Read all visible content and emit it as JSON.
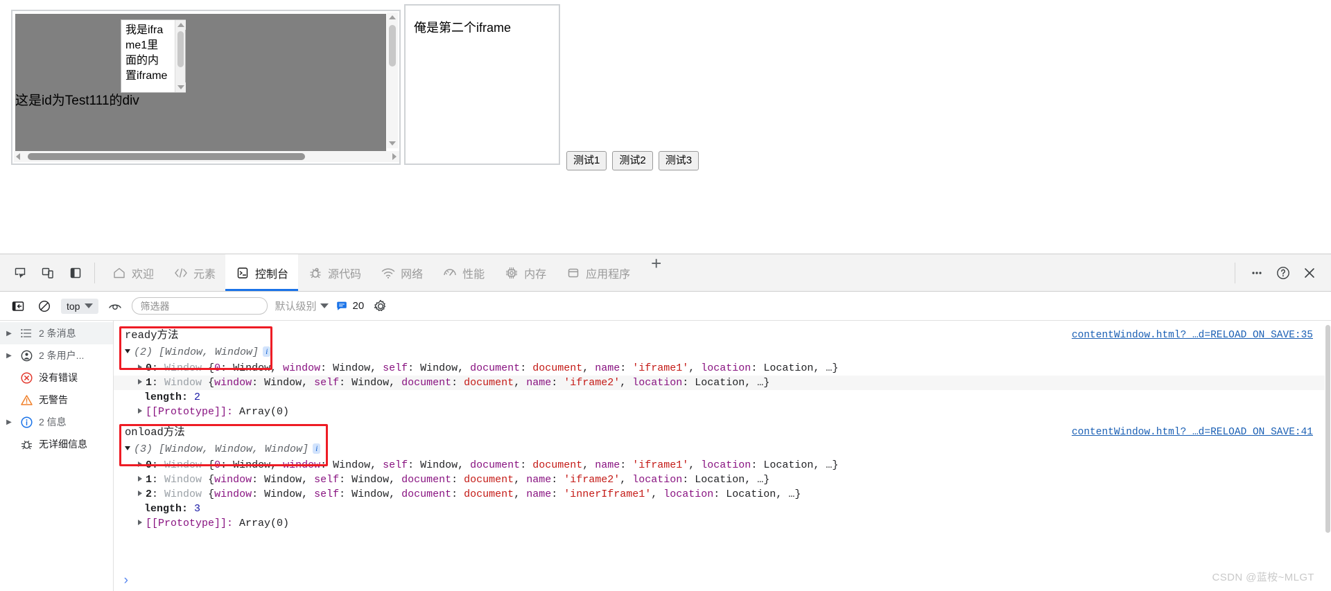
{
  "page": {
    "iframe1": {
      "div_text": "这是id为Test111的div",
      "inner_iframe_text": "我是iframe1里面的内置iframe"
    },
    "iframe2": {
      "text": "俺是第二个iframe"
    },
    "buttons": [
      {
        "label": "测试1",
        "name": "test-1-button"
      },
      {
        "label": "测试2",
        "name": "test-2-button"
      },
      {
        "label": "测试3",
        "name": "test-3-button"
      }
    ]
  },
  "devtools": {
    "left_icons": [
      {
        "name": "inspect-element-icon"
      },
      {
        "name": "device-toolbar-icon"
      },
      {
        "name": "dock-side-panel-icon"
      }
    ],
    "tabs": [
      {
        "label": "欢迎",
        "icon": "home-icon",
        "name": "tab-welcome",
        "active": false
      },
      {
        "label": "元素",
        "icon": "code-brackets-icon",
        "name": "tab-elements",
        "active": false
      },
      {
        "label": "控制台",
        "icon": "console-terminal-icon",
        "name": "tab-console",
        "active": true
      },
      {
        "label": "源代码",
        "icon": "bug-sources-icon",
        "name": "tab-sources",
        "active": false
      },
      {
        "label": "网络",
        "icon": "wifi-network-icon",
        "name": "tab-network",
        "active": false
      },
      {
        "label": "性能",
        "icon": "speedometer-performance-icon",
        "name": "tab-performance",
        "active": false
      },
      {
        "label": "内存",
        "icon": "memory-chip-icon",
        "name": "tab-memory",
        "active": false
      },
      {
        "label": "应用程序",
        "icon": "application-panel-icon",
        "name": "tab-application",
        "active": false
      }
    ],
    "add_tab_label": "+",
    "right_icons": [
      {
        "name": "more-options-icon",
        "glyph": "⋯"
      },
      {
        "name": "help-question-icon",
        "glyph": "?"
      },
      {
        "name": "close-devtools-icon",
        "glyph": "✕"
      }
    ]
  },
  "console_toolbar": {
    "sidebar_toggle": "show-console-sidebar-icon",
    "clear_console": "clear-console-icon",
    "context_value": "top",
    "eye_icon": "live-expression-eye-icon",
    "filter_placeholder": "筛选器",
    "filter_value": "",
    "level_label": "默认级别",
    "issues_count": "20",
    "settings_icon": "settings-gear-icon"
  },
  "console_sidebar": [
    {
      "label": "2 条消息",
      "icon": "messages-list-icon",
      "expandable": true,
      "selected": true
    },
    {
      "label": "2 条用户...",
      "icon": "user-messages-icon",
      "expandable": true,
      "selected": false
    },
    {
      "label": "没有错误",
      "icon": "error-circle-icon",
      "expandable": false,
      "selected": false
    },
    {
      "label": "无警告",
      "icon": "warning-triangle-icon",
      "expandable": false,
      "selected": false
    },
    {
      "label": "2 信息",
      "icon": "info-circle-icon",
      "expandable": true,
      "selected": false
    },
    {
      "label": "无详细信息",
      "icon": "verbose-bug-icon",
      "expandable": false,
      "selected": false
    }
  ],
  "console_log": {
    "group1": {
      "title": "ready方法",
      "source_link": "contentWindow.html?_…d=RELOAD_ON_SAVE:35",
      "array_header": {
        "count": "(2)",
        "preview": "[Window, Window]",
        "badge": "i"
      },
      "rows": [
        {
          "index": "0",
          "type": "Window",
          "body": "{0: Window, window: Window, self: Window, document: document, name: 'iframe1', location: Location, …}",
          "name_value": "'iframe1'"
        },
        {
          "index": "1",
          "type": "Window",
          "body": "{window: Window, self: Window, document: document, name: 'iframe2', location: Location, …}",
          "name_value": "'iframe2'"
        }
      ],
      "length_label": "length:",
      "length_value": "2",
      "prototype_label": "[[Prototype]]:",
      "prototype_value": "Array(0)"
    },
    "group2": {
      "title": "onload方法",
      "source_link": "contentWindow.html?_…d=RELOAD_ON_SAVE:41",
      "array_header": {
        "count": "(3)",
        "preview": "[Window, Window, Window]",
        "badge": "i"
      },
      "rows": [
        {
          "index": "0",
          "type": "Window",
          "body": "{0: Window, window: Window, self: Window, document: document, name: 'iframe1', location: Location, …}",
          "name_value": "'iframe1'"
        },
        {
          "index": "1",
          "type": "Window",
          "body": "{window: Window, self: Window, document: document, name: 'iframe2', location: Location, …}",
          "name_value": "'iframe2'"
        },
        {
          "index": "2",
          "type": "Window",
          "body": "{window: Window, self: Window, document: document, name: 'innerIframe1', location: Location, …}",
          "name_value": "'innerIframe1'"
        }
      ],
      "length_label": "length:",
      "length_value": "3",
      "prototype_label": "[[Prototype]]:",
      "prototype_value": "Array(0)"
    },
    "prompt_caret": "›"
  },
  "watermark": "CSDN @蓝桉~MLGT",
  "colors": {
    "accent_blue": "#1a73e8",
    "link_blue": "#1a5fb4",
    "highlight_red": "#ee1c25",
    "string_red": "#c41a16",
    "key_purple": "#881280",
    "grey_text": "#9aa0a6"
  }
}
